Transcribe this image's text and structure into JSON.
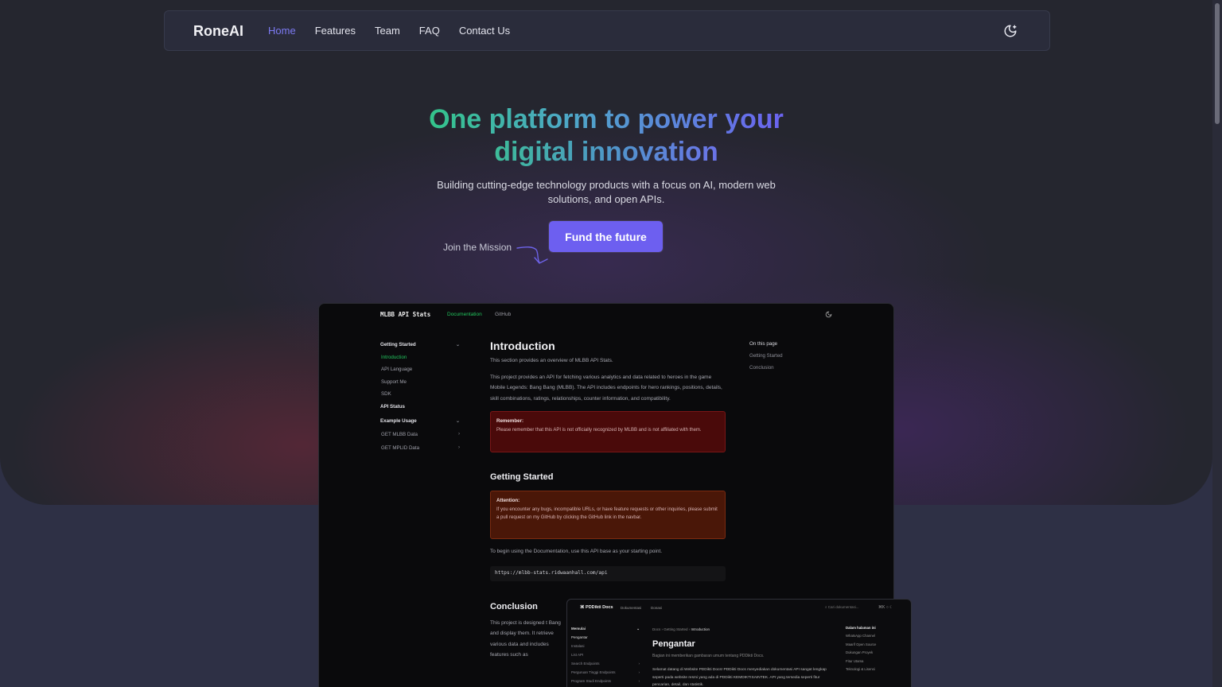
{
  "navbar": {
    "brand": "RoneAI",
    "links": [
      {
        "label": "Home",
        "active": true
      },
      {
        "label": "Features"
      },
      {
        "label": "Team"
      },
      {
        "label": "FAQ"
      },
      {
        "label": "Contact Us"
      }
    ],
    "theme_icon": "moon-icon"
  },
  "hero": {
    "title_line1": "One platform to power your",
    "title_line2": "digital innovation",
    "subtitle": "Building cutting-edge technology products with a focus on AI, modern web solutions, and open APIs.",
    "cta_label": "Fund the future",
    "join_label": "Join the Mission"
  },
  "colors": {
    "accent": "#6d5ff0",
    "nav_active": "#7d7bf5",
    "gradient_start": "#33c48a",
    "gradient_end": "#6b63f0"
  },
  "preview": {
    "brand": "MLBB API Stats",
    "tab_doc": "Documentation",
    "tab_github": "GitHub",
    "sidebar": {
      "getting_started": "Getting Started",
      "introduction": "Introduction",
      "api_language": "API Language",
      "support_me": "Support Me",
      "sdk": "SDK",
      "api_status": "API Status",
      "example_usage": "Example Usage",
      "get_mlbb": "GET MLBB Data",
      "get_mplid": "GET MPLID Data"
    },
    "main": {
      "title": "Introduction",
      "lead": "This section provides an overview of MLBB API Stats.",
      "body": "This project provides an API for fetching various analytics and data related to heroes in the game Mobile Legends: Bang Bang (MLBB). The API includes endpoints for hero rankings, positions, details, skill combinations, ratings, relationships, counter information, and compatibility.",
      "remember_title": "Remember:",
      "remember_body": "Please remember that this API is not officially recognized by MLBB and is not affiliated with them.",
      "getting_started_title": "Getting Started",
      "attention_title": "Attention:",
      "attention_body": "If you encounter any bugs, incompatible URLs, or have feature requests or other inquiries, please submit a pull request on my GitHub by clicking the GitHub link in the navbar.",
      "begin_text": "To begin using the Documentation, use this API base as your starting point.",
      "api_url": "https://mlbb-stats.ridwaanhall.com/api",
      "conclusion_title": "Conclusion",
      "conclusion_body": "This project is designed t Bang and display them. It retrieve various data and includes features such as"
    },
    "toc": {
      "title": "On this page",
      "items": [
        "Getting Started",
        "Conclusion"
      ]
    }
  },
  "preview2": {
    "brand": "PDDikti Docs",
    "tab_doc": "Dokumentasi",
    "tab_other": "Donasi",
    "search_placeholder": "Cari dokumentasi...",
    "kbd": "⌘K",
    "sidebar": {
      "group1": "Memulai",
      "pengantar": "Pengantar",
      "instalasi": "Instalasi",
      "list_api": "List API",
      "search": "Search Endpoints",
      "pt": "Perguruan Tinggi Endpoints",
      "prodi": "Program Studi Endpoints"
    },
    "crumb": {
      "a": "Docs",
      "b": "Getting Started",
      "c": "Introduction"
    },
    "title": "Pengantar",
    "lead": "Bagian ini memberikan gambaran umum tentang PDDikti Docs.",
    "body": "Selamat datang di Website PDDikti Docs! PDDikti Docs menyediakan dokumentasi API sangat lengkap seperti pada website resmi yang ada di PDDikti KEMDIKTISAINTEK. API yang tersedia seperti fitur pencarian, detail, dan statistik.",
    "toc": {
      "title": "Dalam halaman ini",
      "items": [
        "WhatsApp Channel",
        "Maarif Open Source",
        "Dukungan Proyek",
        "Fitur Utama",
        "Teknologi & Lisensi"
      ]
    }
  }
}
